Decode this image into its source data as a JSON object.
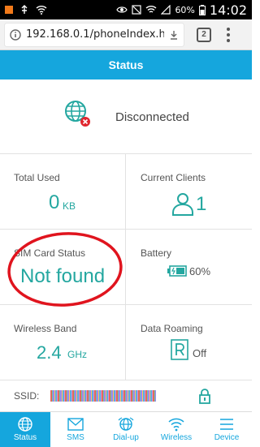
{
  "statusbar": {
    "time": "14:02",
    "battery": "60%"
  },
  "browser": {
    "url": "192.168.0.1/phoneIndex.h",
    "tab_count": "2"
  },
  "header": {
    "title": "Status"
  },
  "connection": {
    "status": "Disconnected",
    "icon": "globe-icon"
  },
  "cells": {
    "total_used": {
      "title": "Total Used",
      "value": "0",
      "unit": "KB"
    },
    "current_clients": {
      "title": "Current Clients",
      "value": "1"
    },
    "sim_card": {
      "title": "SIM Card Status",
      "value": "Not found"
    },
    "battery": {
      "title": "Battery",
      "value": "60%"
    },
    "wireless_band": {
      "title": "Wireless Band",
      "value": "2.4",
      "unit": "GHz"
    },
    "data_roaming": {
      "title": "Data Roaming",
      "value": "Off"
    }
  },
  "ssid": {
    "label": "SSID:"
  },
  "nav": {
    "items": [
      {
        "label": "Status",
        "icon": "globe-icon"
      },
      {
        "label": "SMS",
        "icon": "envelope-icon"
      },
      {
        "label": "Dial-up",
        "icon": "dialup-globe-icon"
      },
      {
        "label": "Wireless",
        "icon": "wifi-icon"
      },
      {
        "label": "Device",
        "icon": "hamburger-icon"
      }
    ]
  },
  "colors": {
    "accent": "#15a6dd",
    "value": "#24a7a0",
    "annotation": "#e0141e",
    "error": "#e0262e"
  }
}
